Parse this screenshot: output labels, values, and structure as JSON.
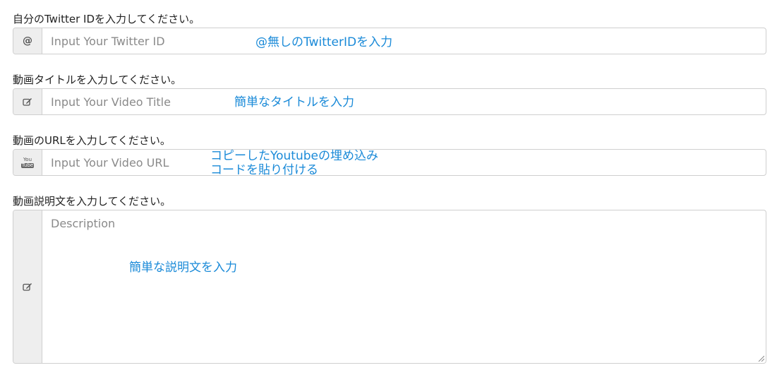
{
  "twitter": {
    "label": "自分のTwitter IDを入力してください。",
    "addon_icon": "at-icon",
    "addon_text": "@",
    "placeholder": "Input Your Twitter ID",
    "value": "",
    "note": "@無しのTwitterIDを入力"
  },
  "title": {
    "label": "動画タイトルを入力してください。",
    "addon_icon": "edit-icon",
    "placeholder": "Input Your Video Title",
    "value": "",
    "note": "簡単なタイトルを入力"
  },
  "url": {
    "label": "動画のURLを入力してください。",
    "addon_icon": "youtube-icon",
    "addon_text_top": "You",
    "addon_text_bottom": "Tube",
    "placeholder": "Input Your Video URL",
    "value": "",
    "note_line1": "コピーしたYoutubeの埋め込み",
    "note_line2": "コードを貼り付ける"
  },
  "description": {
    "label": "動画説明文を入力してください。",
    "addon_icon": "edit-icon",
    "placeholder": "Description",
    "value": "",
    "note": "簡単な説明文を入力"
  },
  "colors": {
    "note": "#1a8ad8",
    "addon_bg": "#eeeeee",
    "border": "#cfcfcf"
  }
}
